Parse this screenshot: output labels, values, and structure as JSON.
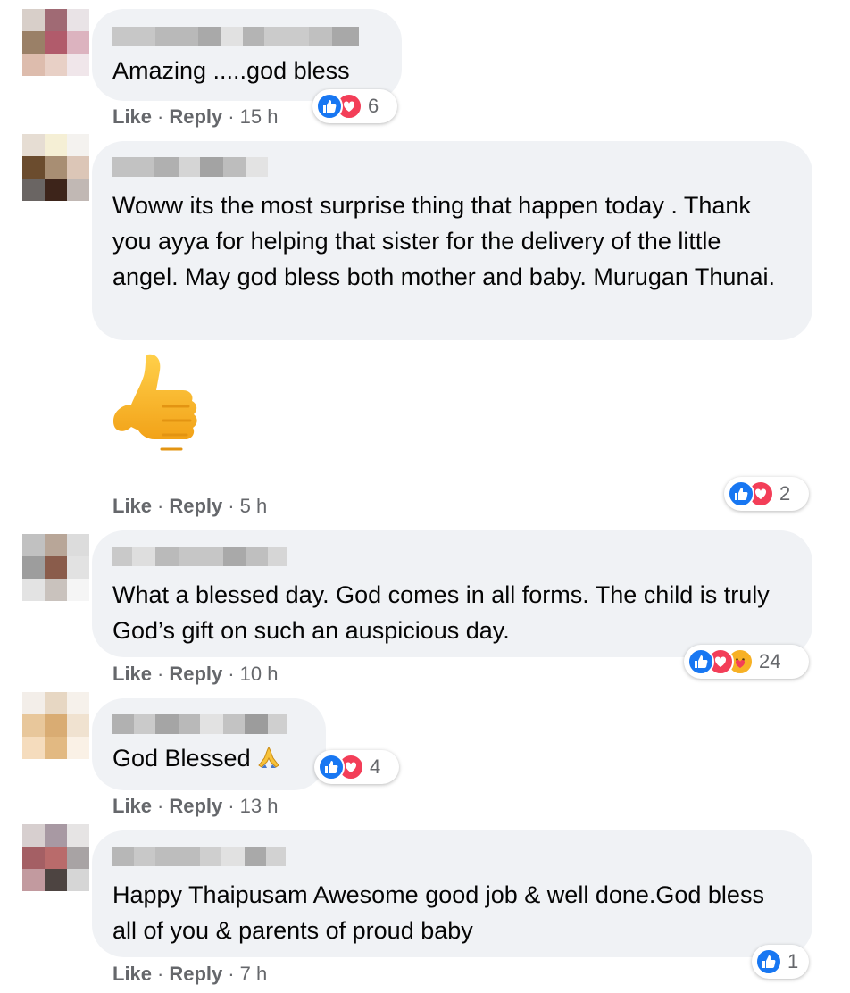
{
  "comments": [
    {
      "text": "Amazing .....god bless",
      "like": "Like",
      "reply": "Reply",
      "time": "15 h",
      "reactions": [
        "like-icon",
        "love-icon"
      ],
      "reaction_count": "6"
    },
    {
      "text": "Woww its the most surprise thing that happen today . Thank you ayya for helping that sister for the delivery of the little angel. May god bless both mother and baby. Murugan Thunai.",
      "sticker": "thumbs-up-sticker",
      "like": "Like",
      "reply": "Reply",
      "time": "5 h",
      "reactions": [
        "like-icon",
        "love-icon"
      ],
      "reaction_count": "2"
    },
    {
      "text": "What a blessed day. God comes in all forms. The child is truly God’s gift on such an auspicious day.",
      "like": "Like",
      "reply": "Reply",
      "time": "10 h",
      "reactions": [
        "like-icon",
        "love-icon",
        "care-icon"
      ],
      "reaction_count": "24"
    },
    {
      "text": "God Blessed",
      "emoji": "folded-hands-emoji",
      "like": "Like",
      "reply": "Reply",
      "time": "13 h",
      "reactions": [
        "like-icon",
        "love-icon"
      ],
      "reaction_count": "4"
    },
    {
      "text": "Happy Thaipusam Awesome good job & well done.God bless all of you & parents of proud baby",
      "like": "Like",
      "reply": "Reply",
      "time": "7 h",
      "reactions": [
        "like-icon"
      ],
      "reaction_count": "1"
    }
  ],
  "separator": "·",
  "colors": {
    "bubble": "#f0f2f5",
    "meta": "#65676b",
    "like": "#1877f2",
    "love": "#f33e58",
    "care": "#f7b125"
  }
}
